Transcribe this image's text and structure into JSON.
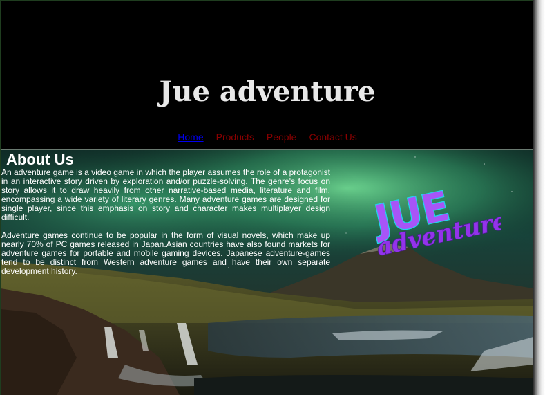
{
  "header": {
    "title": "Jue adventure"
  },
  "nav": {
    "items": [
      {
        "label": "Home",
        "active": true
      },
      {
        "label": "Products",
        "active": false
      },
      {
        "label": "People",
        "active": false
      },
      {
        "label": "Contact Us",
        "active": false
      }
    ]
  },
  "about": {
    "title": "About Us",
    "paragraphs": [
      "An adventure game is a video game in which the player assumes the role of a protagonist in an interactive story driven by exploration and/or puzzle-solving. The genre's focus on story allows it to draw heavily from other narrative-based media, literature and film, encompassing a wide variety of literary genres. Many adventure games are designed for single player, since this emphasis on story and character makes multiplayer design difficult.",
      "Adventure games continue to be popular in the form of visual novels, which make up nearly 70% of PC games released in Japan.Asian countries have also found markets for adventure games for portable and mobile gaming devices. Japanese adventure-games tend to be distinct from Western adventure games and have their own separate development history."
    ]
  },
  "logo": {
    "line1": "JUE",
    "line2": "adventure"
  },
  "colors": {
    "nav_link": "#8b0000",
    "nav_active": "#0000ee",
    "logo_fill": "#a855f7",
    "logo_stroke": "#22d3ee"
  },
  "background": {
    "description_icon": "aurora-mountain-landscape"
  }
}
